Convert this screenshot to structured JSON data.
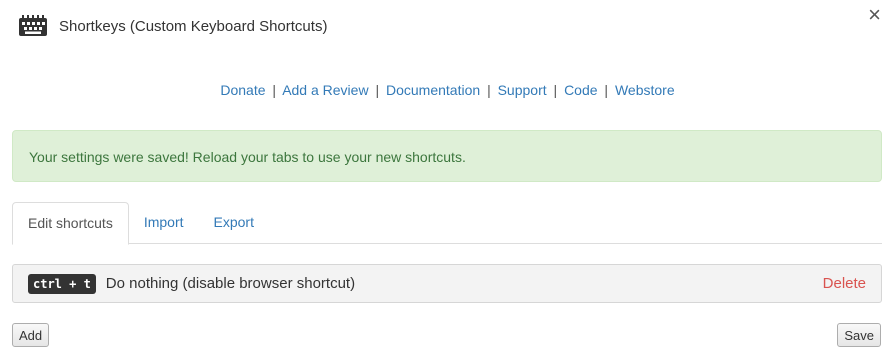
{
  "header": {
    "title": "Shortkeys (Custom Keyboard Shortcuts)",
    "logo_icon": "keyboard-icon",
    "close_label": "×"
  },
  "links": [
    {
      "label": "Donate"
    },
    {
      "label": "Add a Review"
    },
    {
      "label": "Documentation"
    },
    {
      "label": "Support"
    },
    {
      "label": "Code"
    },
    {
      "label": "Webstore"
    }
  ],
  "link_separator": "|",
  "alert": {
    "message": "Your settings were saved! Reload your tabs to use your new shortcuts."
  },
  "tabs": [
    {
      "label": "Edit shortcuts",
      "active": true
    },
    {
      "label": "Import",
      "active": false
    },
    {
      "label": "Export",
      "active": false
    }
  ],
  "shortcuts": [
    {
      "keys": "ctrl + t",
      "action": "Do nothing (disable browser shortcut)",
      "delete_label": "Delete"
    }
  ],
  "buttons": {
    "add_label": "Add",
    "save_label": "Save"
  },
  "colors": {
    "link": "#337ab7",
    "alert_bg": "#dff0d8",
    "alert_text": "#3c763d",
    "delete": "#d9534f"
  }
}
